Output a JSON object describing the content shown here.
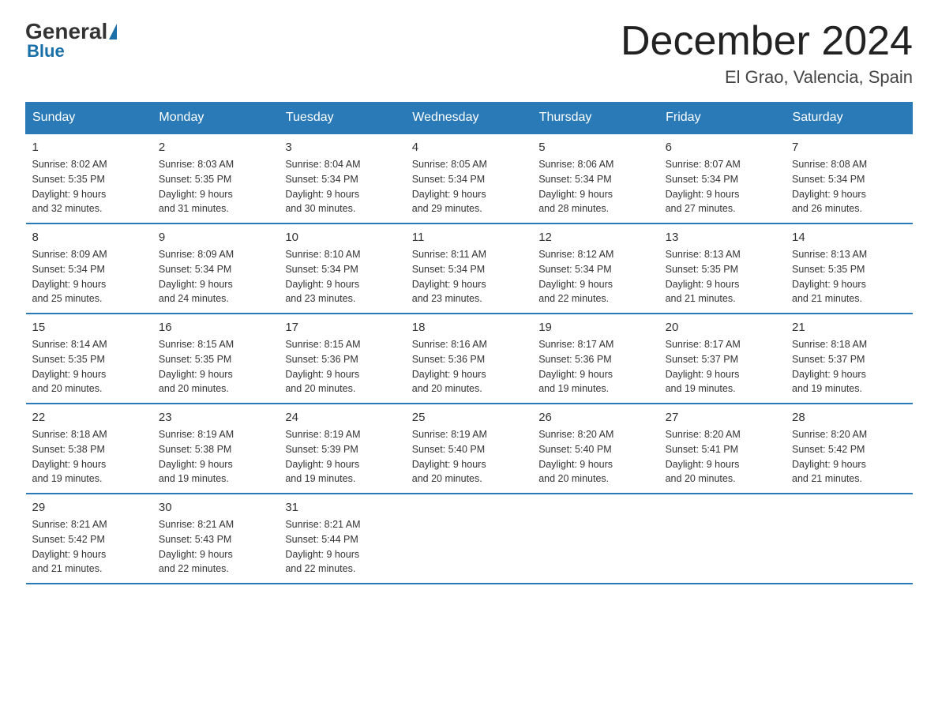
{
  "header": {
    "logo_general": "General",
    "logo_blue": "Blue",
    "title": "December 2024",
    "location": "El Grao, Valencia, Spain"
  },
  "days_of_week": [
    "Sunday",
    "Monday",
    "Tuesday",
    "Wednesday",
    "Thursday",
    "Friday",
    "Saturday"
  ],
  "weeks": [
    [
      {
        "date": "1",
        "sunrise": "8:02 AM",
        "sunset": "5:35 PM",
        "daylight": "9 hours and 32 minutes."
      },
      {
        "date": "2",
        "sunrise": "8:03 AM",
        "sunset": "5:35 PM",
        "daylight": "9 hours and 31 minutes."
      },
      {
        "date": "3",
        "sunrise": "8:04 AM",
        "sunset": "5:34 PM",
        "daylight": "9 hours and 30 minutes."
      },
      {
        "date": "4",
        "sunrise": "8:05 AM",
        "sunset": "5:34 PM",
        "daylight": "9 hours and 29 minutes."
      },
      {
        "date": "5",
        "sunrise": "8:06 AM",
        "sunset": "5:34 PM",
        "daylight": "9 hours and 28 minutes."
      },
      {
        "date": "6",
        "sunrise": "8:07 AM",
        "sunset": "5:34 PM",
        "daylight": "9 hours and 27 minutes."
      },
      {
        "date": "7",
        "sunrise": "8:08 AM",
        "sunset": "5:34 PM",
        "daylight": "9 hours and 26 minutes."
      }
    ],
    [
      {
        "date": "8",
        "sunrise": "8:09 AM",
        "sunset": "5:34 PM",
        "daylight": "9 hours and 25 minutes."
      },
      {
        "date": "9",
        "sunrise": "8:09 AM",
        "sunset": "5:34 PM",
        "daylight": "9 hours and 24 minutes."
      },
      {
        "date": "10",
        "sunrise": "8:10 AM",
        "sunset": "5:34 PM",
        "daylight": "9 hours and 23 minutes."
      },
      {
        "date": "11",
        "sunrise": "8:11 AM",
        "sunset": "5:34 PM",
        "daylight": "9 hours and 23 minutes."
      },
      {
        "date": "12",
        "sunrise": "8:12 AM",
        "sunset": "5:34 PM",
        "daylight": "9 hours and 22 minutes."
      },
      {
        "date": "13",
        "sunrise": "8:13 AM",
        "sunset": "5:35 PM",
        "daylight": "9 hours and 21 minutes."
      },
      {
        "date": "14",
        "sunrise": "8:13 AM",
        "sunset": "5:35 PM",
        "daylight": "9 hours and 21 minutes."
      }
    ],
    [
      {
        "date": "15",
        "sunrise": "8:14 AM",
        "sunset": "5:35 PM",
        "daylight": "9 hours and 20 minutes."
      },
      {
        "date": "16",
        "sunrise": "8:15 AM",
        "sunset": "5:35 PM",
        "daylight": "9 hours and 20 minutes."
      },
      {
        "date": "17",
        "sunrise": "8:15 AM",
        "sunset": "5:36 PM",
        "daylight": "9 hours and 20 minutes."
      },
      {
        "date": "18",
        "sunrise": "8:16 AM",
        "sunset": "5:36 PM",
        "daylight": "9 hours and 20 minutes."
      },
      {
        "date": "19",
        "sunrise": "8:17 AM",
        "sunset": "5:36 PM",
        "daylight": "9 hours and 19 minutes."
      },
      {
        "date": "20",
        "sunrise": "8:17 AM",
        "sunset": "5:37 PM",
        "daylight": "9 hours and 19 minutes."
      },
      {
        "date": "21",
        "sunrise": "8:18 AM",
        "sunset": "5:37 PM",
        "daylight": "9 hours and 19 minutes."
      }
    ],
    [
      {
        "date": "22",
        "sunrise": "8:18 AM",
        "sunset": "5:38 PM",
        "daylight": "9 hours and 19 minutes."
      },
      {
        "date": "23",
        "sunrise": "8:19 AM",
        "sunset": "5:38 PM",
        "daylight": "9 hours and 19 minutes."
      },
      {
        "date": "24",
        "sunrise": "8:19 AM",
        "sunset": "5:39 PM",
        "daylight": "9 hours and 19 minutes."
      },
      {
        "date": "25",
        "sunrise": "8:19 AM",
        "sunset": "5:40 PM",
        "daylight": "9 hours and 20 minutes."
      },
      {
        "date": "26",
        "sunrise": "8:20 AM",
        "sunset": "5:40 PM",
        "daylight": "9 hours and 20 minutes."
      },
      {
        "date": "27",
        "sunrise": "8:20 AM",
        "sunset": "5:41 PM",
        "daylight": "9 hours and 20 minutes."
      },
      {
        "date": "28",
        "sunrise": "8:20 AM",
        "sunset": "5:42 PM",
        "daylight": "9 hours and 21 minutes."
      }
    ],
    [
      {
        "date": "29",
        "sunrise": "8:21 AM",
        "sunset": "5:42 PM",
        "daylight": "9 hours and 21 minutes."
      },
      {
        "date": "30",
        "sunrise": "8:21 AM",
        "sunset": "5:43 PM",
        "daylight": "9 hours and 22 minutes."
      },
      {
        "date": "31",
        "sunrise": "8:21 AM",
        "sunset": "5:44 PM",
        "daylight": "9 hours and 22 minutes."
      },
      null,
      null,
      null,
      null
    ]
  ],
  "labels": {
    "sunrise": "Sunrise:",
    "sunset": "Sunset:",
    "daylight": "Daylight:"
  }
}
